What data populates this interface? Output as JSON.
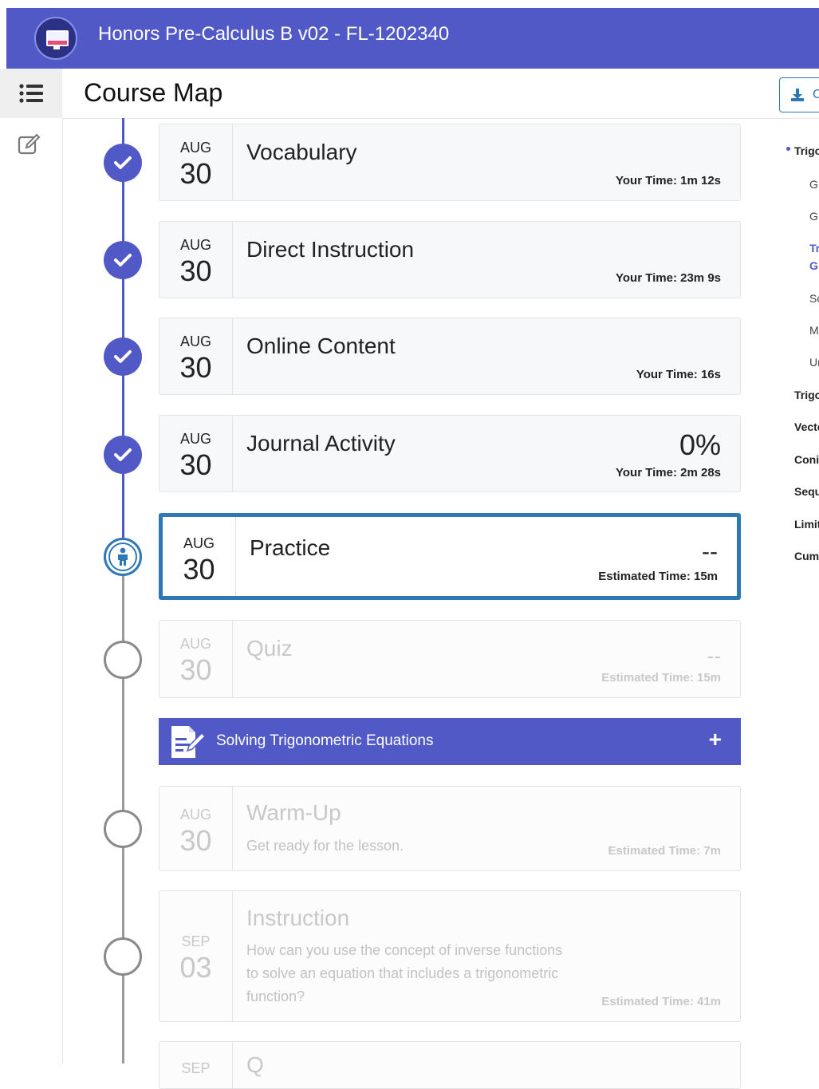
{
  "app": {
    "title": "Honors Pre-Calculus B v02 - FL-1202340"
  },
  "page": {
    "heading": "Course Map",
    "download_label": "C"
  },
  "activities": [
    {
      "mon": "AUG",
      "day": "30",
      "title": "Vocabulary",
      "time": "Your Time: 1m 12s",
      "status": "complete"
    },
    {
      "mon": "AUG",
      "day": "30",
      "title": "Direct Instruction",
      "time": "Your Time: 23m 9s",
      "status": "complete"
    },
    {
      "mon": "AUG",
      "day": "30",
      "title": "Online Content",
      "time": "Your Time: 16s",
      "status": "complete"
    },
    {
      "mon": "AUG",
      "day": "30",
      "title": "Journal Activity",
      "score": "0%",
      "time": "Your Time: 2m 28s",
      "status": "complete"
    },
    {
      "mon": "AUG",
      "day": "30",
      "title": "Practice",
      "score": "--",
      "time": "Estimated Time: 15m",
      "status": "current"
    },
    {
      "mon": "AUG",
      "day": "30",
      "title": "Quiz",
      "score": "--",
      "time": "Estimated Time: 15m",
      "status": "locked"
    }
  ],
  "lesson": {
    "title": "Solving Trigonometric Equations",
    "expand": "+"
  },
  "lesson_activities": [
    {
      "mon": "AUG",
      "day": "30",
      "title": "Warm-Up",
      "desc": "Get ready for the lesson.",
      "time": "Estimated Time: 7m",
      "status": "locked"
    },
    {
      "mon": "SEP",
      "day": "03",
      "title": "Instruction",
      "desc": "How can you use the concept of inverse functions to solve an equation that includes a trigonometric function?",
      "time": "Estimated Time: 41m",
      "status": "locked"
    },
    {
      "mon": "SEP",
      "day": "",
      "title": "Q",
      "status": "locked"
    }
  ],
  "toc": {
    "items": [
      {
        "label": "Trigo",
        "kind": "unit-active"
      },
      {
        "label": "G",
        "kind": "sub"
      },
      {
        "label": "G",
        "kind": "sub"
      },
      {
        "label": "Tr",
        "kind": "sub-active"
      },
      {
        "label": "G",
        "kind": "sub-active"
      },
      {
        "label": "So",
        "kind": "sub"
      },
      {
        "label": "M",
        "kind": "sub"
      },
      {
        "label": "Ur",
        "kind": "sub"
      },
      {
        "label": "Trigo",
        "kind": "unit"
      },
      {
        "label": "Vecto",
        "kind": "unit"
      },
      {
        "label": "Coni",
        "kind": "unit"
      },
      {
        "label": "Sequ",
        "kind": "unit"
      },
      {
        "label": "Limit",
        "kind": "unit"
      },
      {
        "label": "Cum",
        "kind": "unit"
      }
    ]
  },
  "colors": {
    "brand": "#5159c7",
    "current": "#2f78b6",
    "locked_line": "#9a9a9a"
  }
}
